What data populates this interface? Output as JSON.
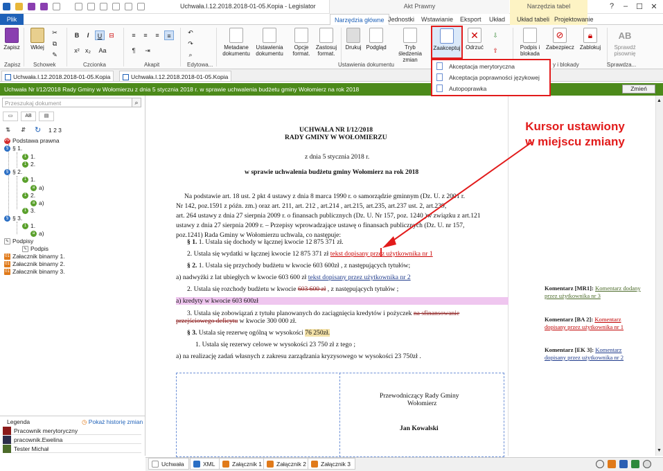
{
  "window": {
    "title": "Uchwała.I.12.2018.2018-01-05.Kopia - Legislator",
    "context_group": "Akt Prawny",
    "context_tab_group": "Narzędzia tabel"
  },
  "ribbon_tabs": [
    "Plik",
    "Narzędzia główne",
    "Jednostki",
    "Wstawianie",
    "Eksport",
    "Układ",
    "Układ tabeli",
    "Projektowanie"
  ],
  "ribbon": {
    "groups": {
      "zapisz": "Zapisz",
      "schowek": "Schowek",
      "czcionka": "Czcionka",
      "akapit": "Akapit",
      "edytowanie": "Edytowa...",
      "ustawienia": "Ustawienia dokumentu",
      "podpisy": "y i blokady",
      "sprawdzanie": "Sprawdza..."
    },
    "buttons": {
      "zapisz": "Zapisz",
      "wklej": "Wklej",
      "metadane": "Metadane dokumentu",
      "ustawienia": "Ustawienia dokumentu",
      "opcje": "Opcje format.",
      "zastosuj": "Zastosuj format.",
      "drukuj": "Drukuj",
      "podglad": "Podgląd",
      "tryb": "Tryb śledzenia zmian",
      "zaakceptuj": "Zaakceptuj",
      "odrzuc": "Odrzuć",
      "podpis": "Podpis i blokada",
      "zabezpiecz": "Zabezpiecz",
      "zablokuj": "Zablokuj",
      "sprawdz": "Sprawdź pisownię"
    },
    "dropdown": [
      "Akceptacja merytoryczna",
      "Akceptacja poprawności językowej",
      "Autopoprawka"
    ]
  },
  "doc_tabs": [
    "Uchwała.I.12.2018.2018-01-05.Kopia",
    "Uchwała.I.12.2018.2018-01-05.Kopia"
  ],
  "green_bar": {
    "title": "Uchwała Nr I/12/2018 Rady Gminy w Wołomierzu z dnia 5 stycznia 2018 r. w sprawie uchwalenia budżetu gminy Wołomierz na rok 2018",
    "button": "Zmień"
  },
  "left_panel": {
    "search_placeholder": "Przeszukaj dokument",
    "level_numbers": "1 2 3",
    "tree": [
      "Podstawa prawna",
      "§ 1.",
      "1.",
      "2.",
      "§ 2.",
      "1.",
      "a)",
      "2.",
      "a)",
      "3.",
      "§ 3.",
      "1.",
      "a)",
      "Podpisy",
      "Podpis",
      "Załacznik binarny 1.",
      "Załacznik binarny 2.",
      "Załacznik binarny 3."
    ],
    "legend_title": "Legenda",
    "legend_history": "Pokaż historię zmian",
    "legend": [
      {
        "label": "Pracownik merytoryczny",
        "color": "#8b1a1a"
      },
      {
        "label": "pracownik.Ewelina",
        "color": "#2d2d4a"
      },
      {
        "label": "Tester Michał",
        "color": "#4c6b2a"
      }
    ]
  },
  "document": {
    "title1": "UCHWAŁA NR I/12/2018",
    "title2": "RADY GMINY W WOŁOMIERZU",
    "date": "z dnia 5 stycznia 2018 r.",
    "subject": "w sprawie uchwalenia budżetu gminy Wołomierz na rok 2018",
    "preamble": [
      "Na  podstawie  art. 18 ust. 2 pkt 4 ustawy  z dnia  8 marca  1990 r.  o samorządzie  gminnym  (Dz. U.  z 2001 r.",
      "Nr 142,  poz.1591  z późn.  zm.)  oraz  art. 211,  art. 212 ,  art.214  ,  art.215,    art.235,   art.237  ust. 2,  art.239,",
      "art. 264 ustawy z dnia 27 sierpnia 2009 r. o finansach publicznych  (Dz. U. Nr 157, poz. 1240 )w związku z art.121",
      "ustawy z dnia 27 sierpnia  2009 r.  –  Przepisy  wprowadzające  ustawę  o finansach  publicznych  (Dz. U.  nr 157,",
      "poz.1241) Rada Gminy w Wołomierzu uchwala, co następuje:"
    ],
    "p1_mark": "§ 1.",
    "p1": "1. Ustala się dochody w łącznej kwocie 12 875 371 zł.",
    "p2a": "2. Ustala się wydatki w łącznej  kwocie 12 875 371 zł",
    "p2_ins": "tekst dopisany przez użytkownika nr 1",
    "p3_mark": "§ 2.",
    "p3": "1. Ustala się przychody  budżetu w kwocie 603 600zł , z następujących tytułów;",
    "p4a": "a) nadwyżki z lat ubiegłych w kwocie 603 600 zł",
    "p4_ins": "tekst dopisany przez użytkownika nr 2",
    "p5a": "2. Ustala się  rozchody budżetu w kwocie",
    "p5_del": "603 600 zł",
    "p5b": ", z następujących tytułów ;",
    "p6": "a) kredyty w kwocie 603 600zł",
    "p7a": "3. Ustala  się  zobowiązań  z tytułu  planowanych  do  zaciągnięcia  kredytów  i pożyczek",
    "p7_del1": "na  sfinansowanie",
    "p7_del2": "przejściowego deficytu",
    "p7b": "w kwocie 300 000 zł.",
    "p8_mark": "§ 3.",
    "p8a": "Ustala się  rezerwę ogólną w wysokości",
    "p8_hl": "76 250zł.",
    "p9": "1. Ustala się  rezerwy celowe w wysokości 23 750 zł z tego ;",
    "p10": "a) na realizację zadań własnych z zakresu zarządzania kryzysowego w wysokości 23 750zł .",
    "sign1": "Przewodniczący Rady Gminy",
    "sign2": "Wołomierz",
    "sign3": "Jan Kowalski"
  },
  "comments": [
    {
      "tag": "Komentarz [MR1]:",
      "text1": "Komentarz dodany",
      "text2": "przez użytkownika nr 3",
      "color": "#4c6b2a"
    },
    {
      "tag": "Komentarz [BA 2]:",
      "text1": "Komentarz",
      "text2": "dopisany przez użytkownika nr 1",
      "color": "#c00000"
    },
    {
      "tag": "Komentarz [EK 3]:",
      "text1": "Komentarz",
      "text2": "dopisany przez użytkownika nr 2",
      "color": "#1f3b8c"
    }
  ],
  "annotation": {
    "line1": "Kursor ustawiony",
    "line2": "w miejscu zmiany"
  },
  "bottom_tabs": [
    "Uchwała",
    "XML",
    "Załącznik 1",
    "Załącznik 2",
    "Załącznik 3"
  ]
}
